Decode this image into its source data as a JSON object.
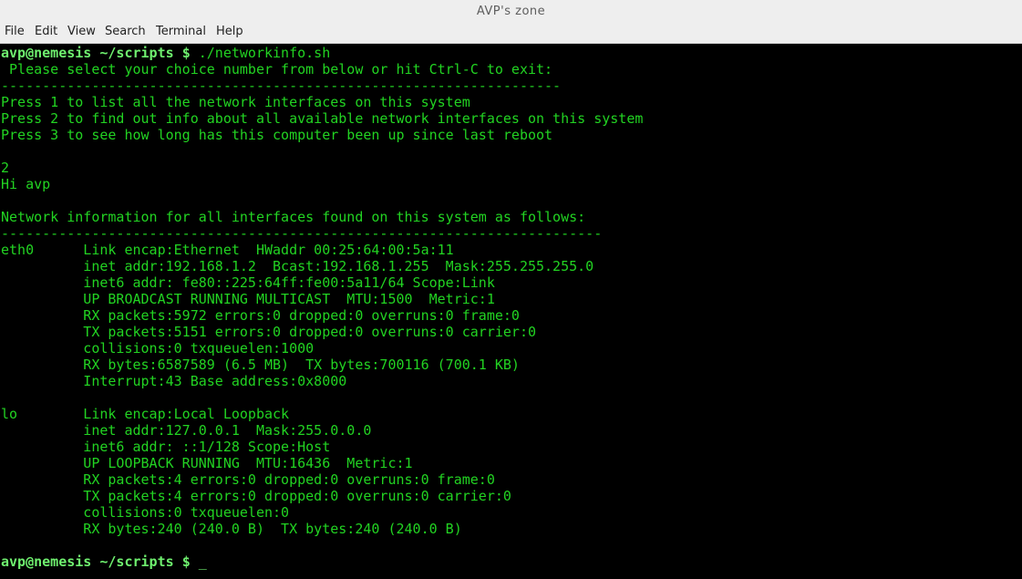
{
  "window": {
    "title": "AVP's zone"
  },
  "menu": [
    "File",
    "Edit",
    "View",
    "Search",
    "Terminal",
    "Help"
  ],
  "prompt": {
    "user_host": "avp@nemesis",
    "path": "~/scripts",
    "symbol": "$"
  },
  "command": "./networkinfo.sh",
  "cursor": "_",
  "output": [
    " Please select your choice number from below or hit Ctrl-C to exit:",
    "--------------------------------------------------------------------",
    "Press 1 to list all the network interfaces on this system",
    "Press 2 to find out info about all available network interfaces on this system",
    "Press 3 to see how long has this computer been up since last reboot",
    "",
    "2",
    "Hi avp",
    "",
    "Network information for all interfaces found on this system as follows:",
    "-------------------------------------------------------------------------",
    "eth0      Link encap:Ethernet  HWaddr 00:25:64:00:5a:11  ",
    "          inet addr:192.168.1.2  Bcast:192.168.1.255  Mask:255.255.255.0",
    "          inet6 addr: fe80::225:64ff:fe00:5a11/64 Scope:Link",
    "          UP BROADCAST RUNNING MULTICAST  MTU:1500  Metric:1",
    "          RX packets:5972 errors:0 dropped:0 overruns:0 frame:0",
    "          TX packets:5151 errors:0 dropped:0 overruns:0 carrier:0",
    "          collisions:0 txqueuelen:1000 ",
    "          RX bytes:6587589 (6.5 MB)  TX bytes:700116 (700.1 KB)",
    "          Interrupt:43 Base address:0x8000 ",
    "",
    "lo        Link encap:Local Loopback  ",
    "          inet addr:127.0.0.1  Mask:255.0.0.0",
    "          inet6 addr: ::1/128 Scope:Host",
    "          UP LOOPBACK RUNNING  MTU:16436  Metric:1",
    "          RX packets:4 errors:0 dropped:0 overruns:0 frame:0",
    "          TX packets:4 errors:0 dropped:0 overruns:0 carrier:0",
    "          collisions:0 txqueuelen:0 ",
    "          RX bytes:240 (240.0 B)  TX bytes:240 (240.0 B)",
    ""
  ],
  "colors": {
    "text": "#22d322",
    "prompt": "#6ff06f",
    "background": "#000000",
    "chrome": "#eeeeee"
  }
}
